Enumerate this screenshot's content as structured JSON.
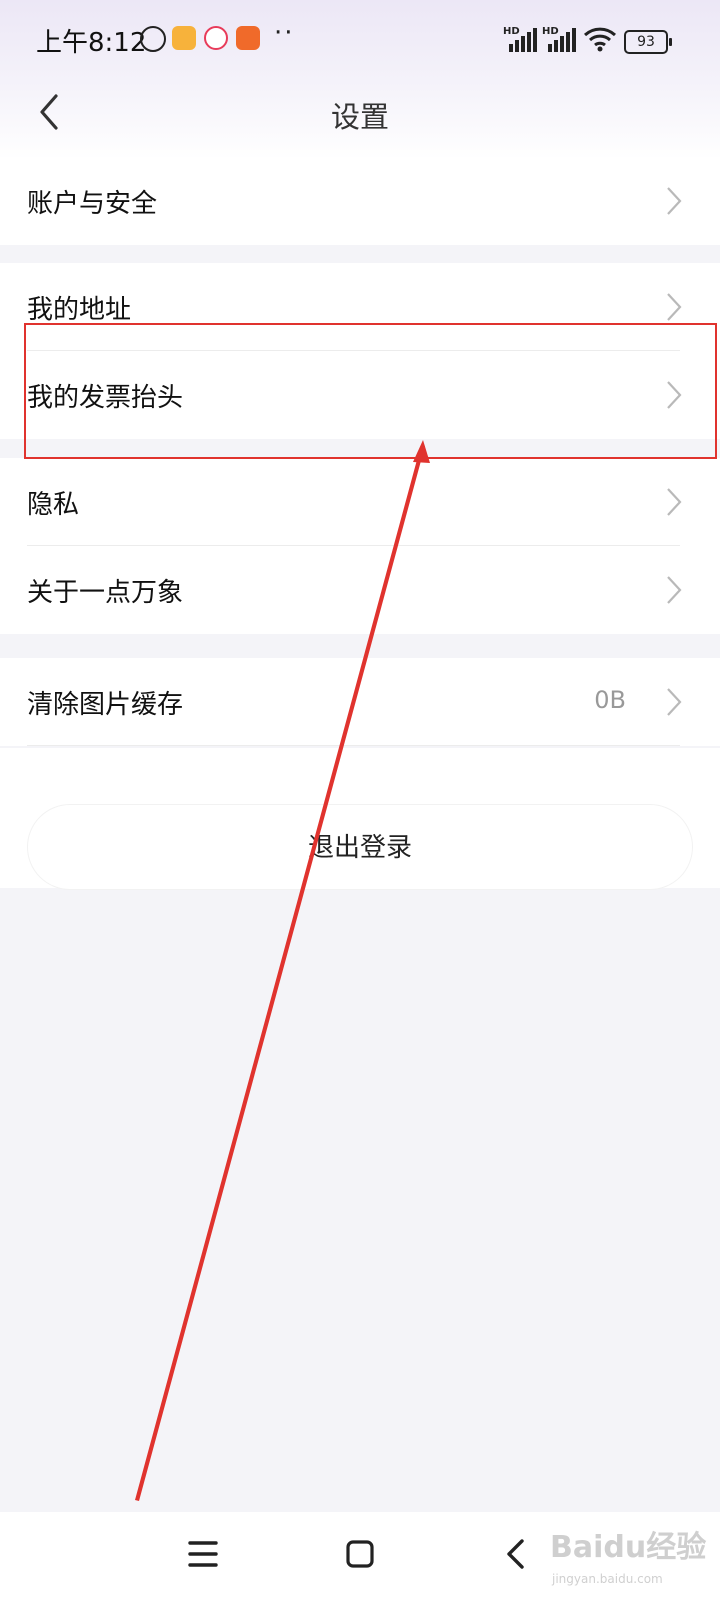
{
  "status_bar": {
    "time": "上午8:12",
    "signal1_label": "HD",
    "signal2_label": "HD",
    "battery": "93"
  },
  "header": {
    "title": "设置",
    "back_icon": "chevron-left-icon"
  },
  "groups": [
    {
      "items": [
        {
          "label": "账户与安全"
        }
      ]
    },
    {
      "items": [
        {
          "label": "我的地址"
        },
        {
          "label": "我的发票抬头"
        }
      ]
    },
    {
      "items": [
        {
          "label": "隐私"
        },
        {
          "label": "关于一点万象"
        }
      ]
    },
    {
      "items": [
        {
          "label": "清除图片缓存",
          "value": "0B"
        }
      ]
    }
  ],
  "logout_label": "退出登录",
  "annotation": {
    "color": "#e0332e"
  },
  "navbar": {
    "menu_icon": "menu-icon",
    "home_icon": "home-icon",
    "back_icon": "back-icon"
  },
  "watermark": {
    "main": "Baidu经验",
    "sub": "jingyan.baidu.com"
  }
}
